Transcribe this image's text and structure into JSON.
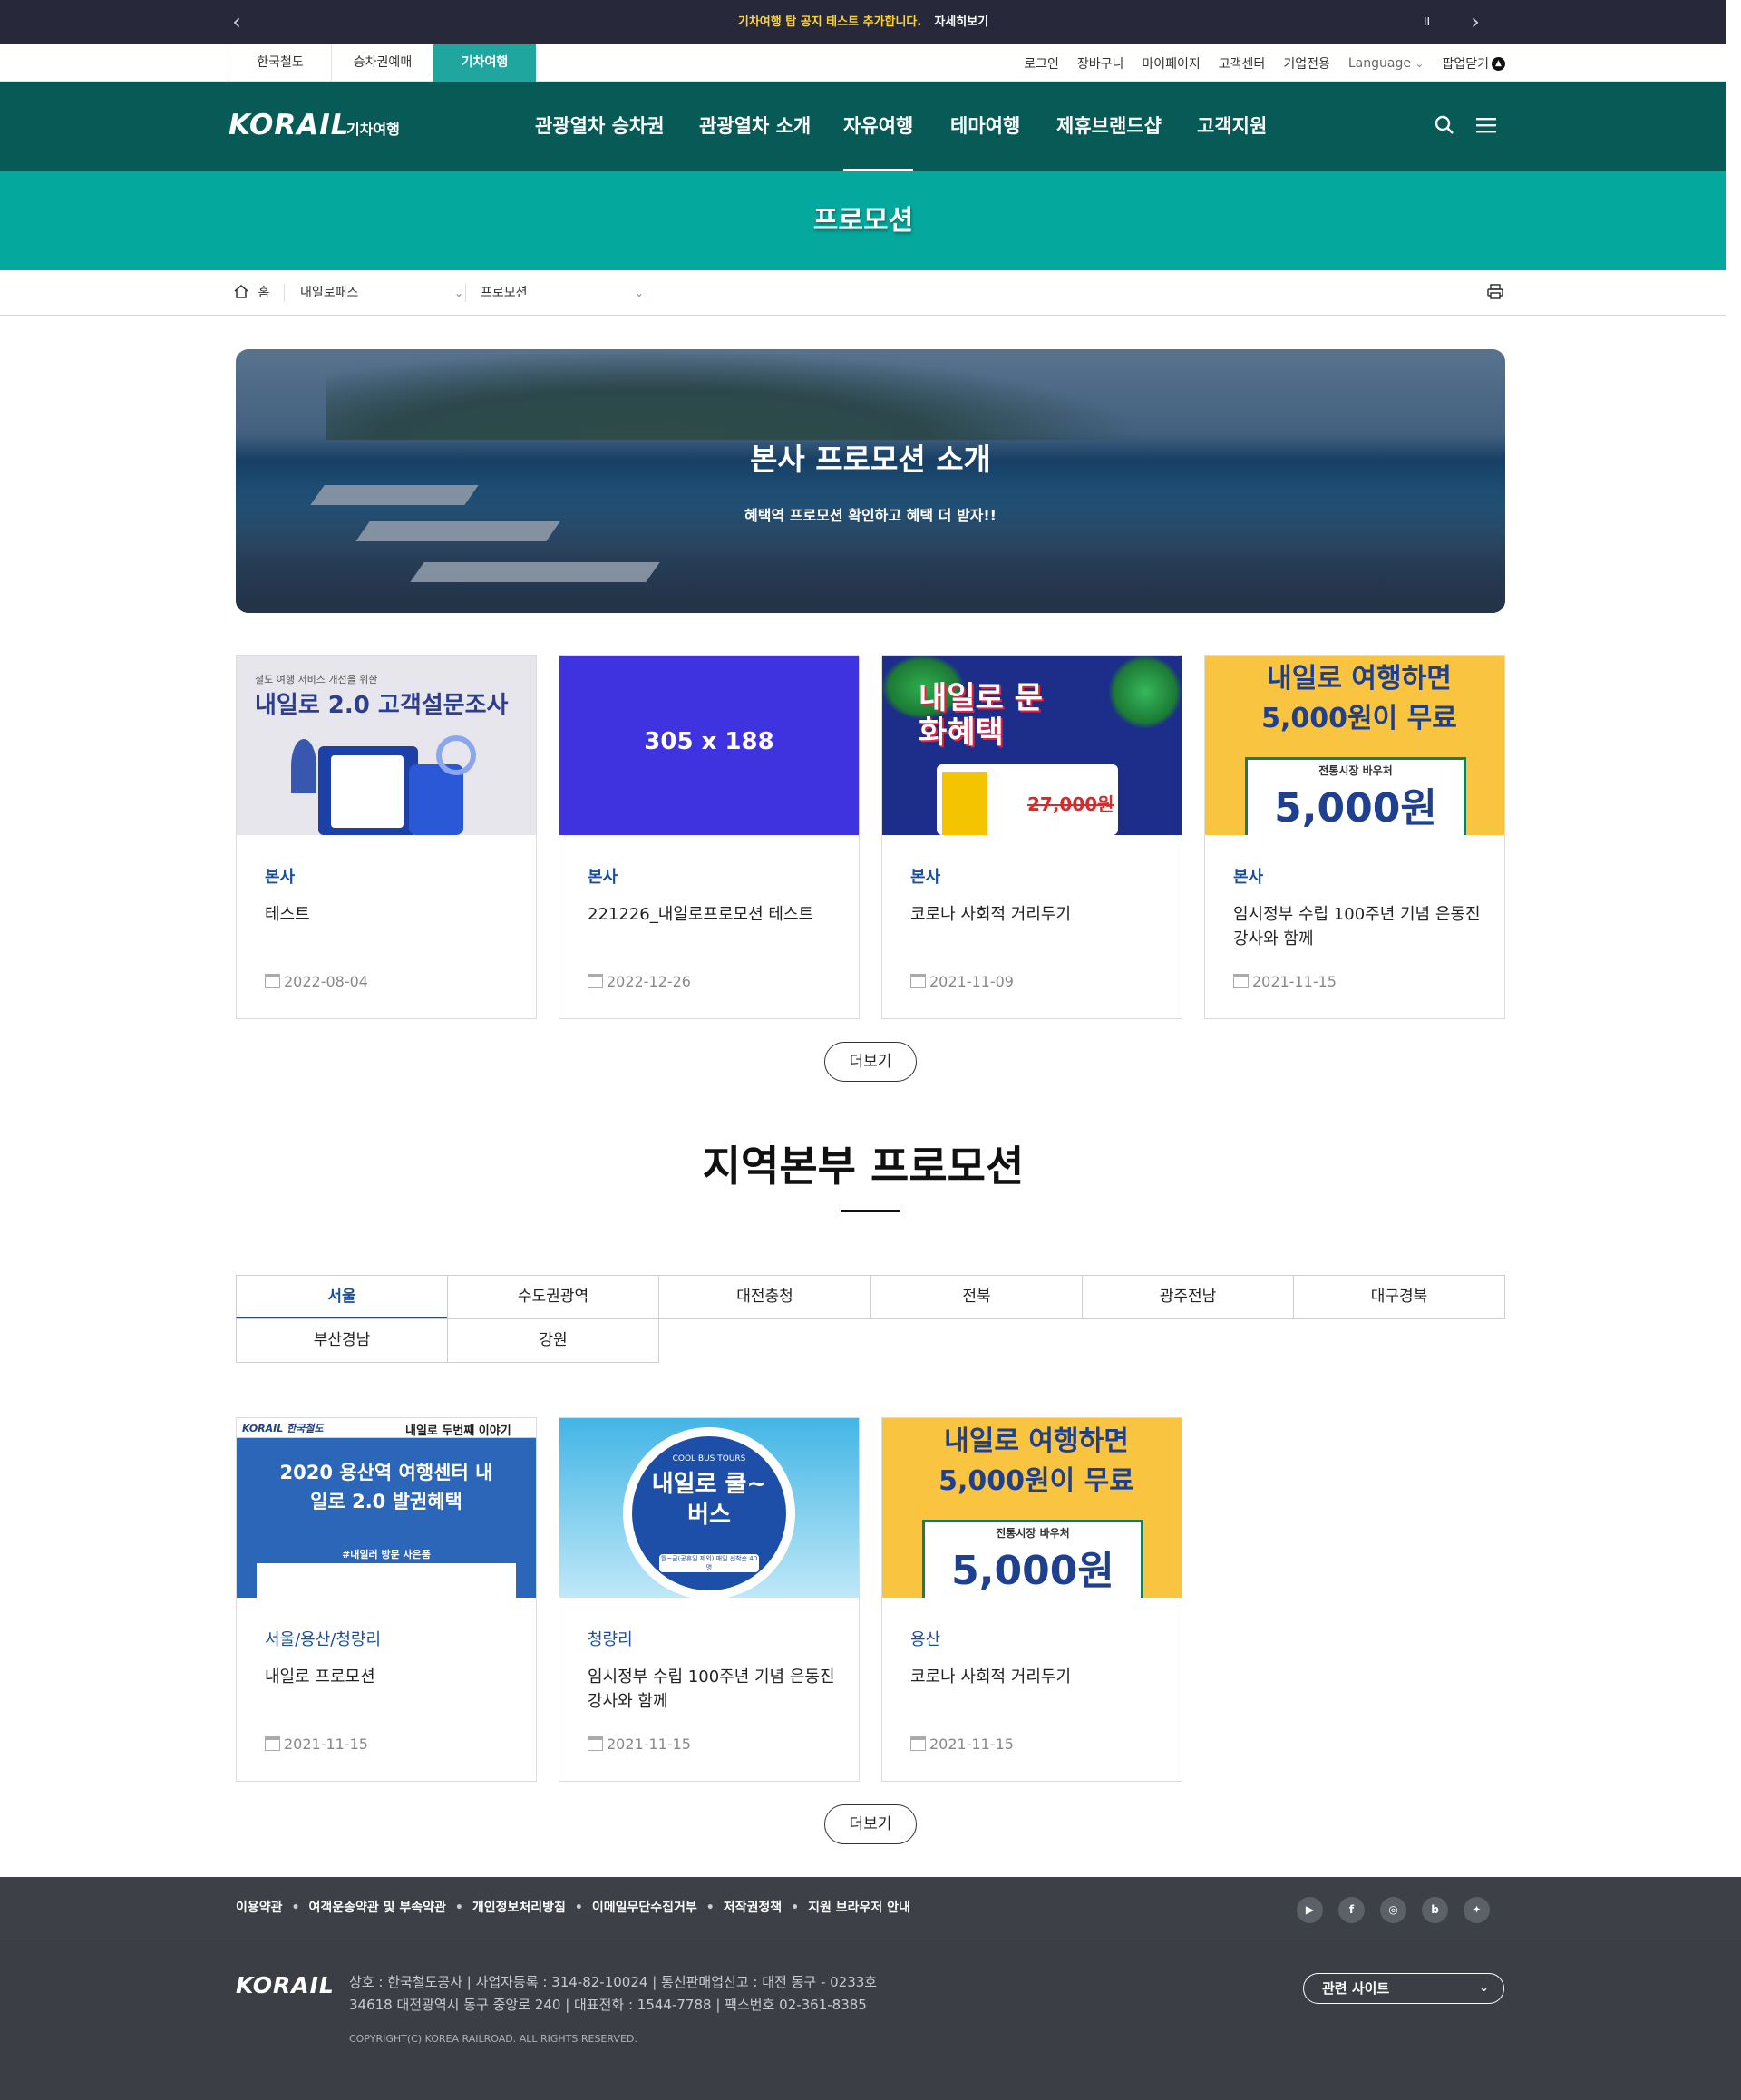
{
  "notice": {
    "message": "기차여행 탑 공지 테스트 추가합니다.",
    "more": "자세히보기",
    "pause": "II",
    "prev": "‹",
    "next": "›"
  },
  "util": {
    "sites": [
      "한국철도",
      "승차권예매",
      "기차여행"
    ],
    "links": [
      "로그인",
      "장바구니",
      "마이페이지",
      "고객센터",
      "기업전용"
    ],
    "language": "Language",
    "popup_close": "팝업닫기"
  },
  "gnb": {
    "logo": "KORAIL",
    "logo_sub": "기차여행",
    "menu": [
      "관광열차 승차권",
      "관광열차 소개",
      "자유여행",
      "테마여행",
      "제휴브랜드샵",
      "고객지원"
    ],
    "active": "자유여행",
    "icons": [
      "search-icon",
      "menu-icon"
    ]
  },
  "page_title": "프로모션",
  "breadcrumb": {
    "home": "홈",
    "level1": "내일로패스",
    "level2": "프로모션"
  },
  "hero": {
    "title": "본사 프로모션 소개",
    "subtitle": "혜택역 프로모션 확인하고 혜택 더 받자!!"
  },
  "hq_cards": [
    {
      "category": "본사",
      "title": "테스트",
      "date": "2022-08-04",
      "thumb_small": "철도 여행 서비스 개선을 위한",
      "thumb_big": "내일로 2.0 고객설문조사"
    },
    {
      "category": "본사",
      "title": "221226_내일로프로모션 테스트",
      "date": "2022-12-26",
      "thumb_big": "305 x 188"
    },
    {
      "category": "본사",
      "title": "코로나 사회적 거리두기",
      "date": "2021-11-09",
      "thumb_big": "내일로 문화혜택",
      "thumb_small": "27,000원"
    },
    {
      "category": "본사",
      "title": "임시정부 수립 100주년 기념 은동진 강사와 함께",
      "date": "2021-11-15",
      "thumb_big": "내일로 여행하면 5,000원이 무료",
      "thumb_small": "전통시장 바우처",
      "thumb_amount": "5,000원"
    }
  ],
  "more_label": "더보기",
  "region_section": {
    "title": "지역본부 프로모션",
    "tabs": [
      "서울",
      "수도권광역",
      "대전충청",
      "전북",
      "광주전남",
      "대구경북",
      "부산경남",
      "강원"
    ],
    "active_tab": "서울"
  },
  "region_cards": [
    {
      "category": "서울/용산/청량리",
      "title": "내일로 프로모션",
      "date": "2021-11-15",
      "thumb_top": "내일로 두번째 이야기",
      "thumb_big": "2020 용산역 여행센터 내일로 2.0 발권혜택",
      "thumb_small": "#내일러 방문 사은품",
      "thumb_logo": "KORAIL 한국철도"
    },
    {
      "category": "청량리",
      "title": "임시정부 수립 100주년 기념 은동진 강사와 함께",
      "date": "2021-11-15",
      "thumb_small": "COOL BUS TOURS",
      "thumb_big": "내일로 쿨~버스",
      "thumb_note": "월~금(공휴일 제외) 매일 선착순 40명"
    },
    {
      "category": "용산",
      "title": "코로나 사회적 거리두기",
      "date": "2021-11-15",
      "thumb_big": "내일로 여행하면 5,000원이 무료",
      "thumb_small": "전통시장 바우처",
      "thumb_amount": "5,000원"
    }
  ],
  "footer": {
    "links": [
      "이용약관",
      "여객운송약관 및 부속약관",
      "개인정보처리방침",
      "이메일무단수집거부",
      "저작권정책",
      "지원 브라우저 안내"
    ],
    "sns": [
      "youtube-icon",
      "facebook-icon",
      "instagram-icon",
      "blog-icon",
      "twitter-icon"
    ],
    "logo": "KORAIL",
    "info1": "상호 : 한국철도공사  |  사업자등록 : 314-82-10024  |  통신판매업신고 : 대전 동구 - 0233호",
    "info2": "34618 대전광역시 동구 중앙로 240  |  대표전화 : 1544-7788  |  팩스번호 02-361-8385",
    "copyright": "COPYRIGHT(C) KOREA RAILROAD. ALL RIGHTS RESERVED.",
    "related": "관련 사이트"
  },
  "colors": {
    "accent": "#04a89d",
    "gnb": "#075a55",
    "link_blue": "#1a4fa0",
    "notice_bg": "#27293b",
    "footer_bg": "#3b3e44"
  }
}
